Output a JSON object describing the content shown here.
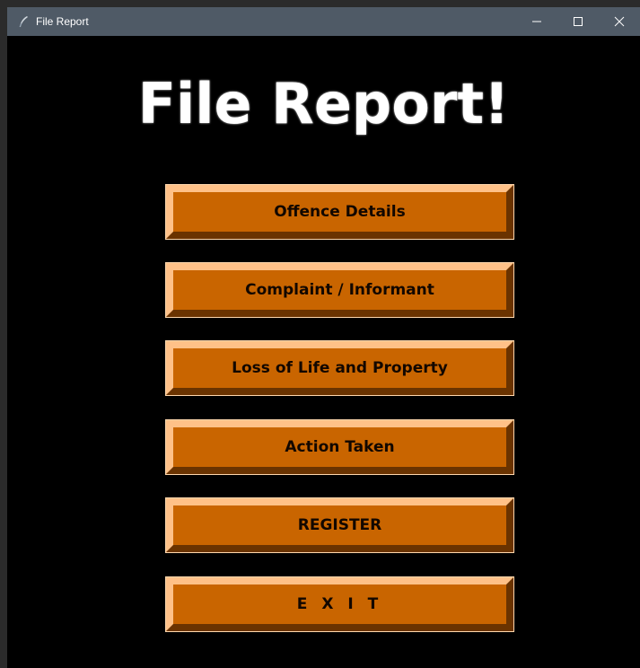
{
  "window": {
    "title": "File Report",
    "controls": {
      "minimize": "—",
      "maximize": "☐",
      "close": "✕"
    }
  },
  "main": {
    "heading": "File Report!",
    "buttons": [
      {
        "label": "Offence Details"
      },
      {
        "label": "Complaint / Informant"
      },
      {
        "label": "Loss of Life and Property"
      },
      {
        "label": "Action Taken"
      },
      {
        "label": "REGISTER"
      },
      {
        "label": "E X I T"
      }
    ]
  },
  "colors": {
    "titlebar": "#4f5a66",
    "background": "#000000",
    "button_face": "#c96500",
    "button_highlight": "#ffc188",
    "button_shadow": "#6a3300",
    "heading_text": "#ffffff"
  },
  "icons": {
    "app": "feather-icon"
  }
}
